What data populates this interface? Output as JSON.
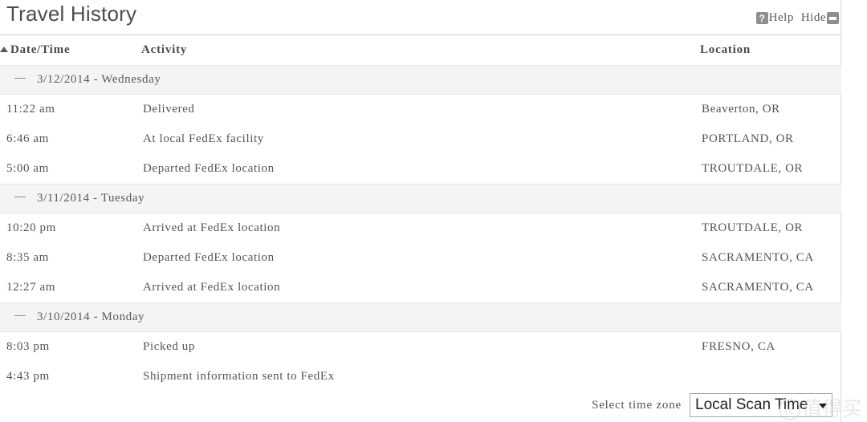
{
  "header": {
    "title": "Travel History",
    "help_label": "Help",
    "help_icon": "question-mark-icon",
    "hide_label": "Hide",
    "hide_icon": "minimize-icon"
  },
  "table": {
    "columns": {
      "datetime": "Date/Time",
      "activity": "Activity",
      "location": "Location"
    },
    "sort": {
      "column": "Date/Time",
      "direction": "ascending",
      "icon": "sort-ascending-triangle-icon"
    },
    "groups": [
      {
        "date": "3/12/2014",
        "separator": "-",
        "weekday": "Wednesday",
        "label": "3/12/2014 - Wednesday",
        "collapse_icon": "collapse-dash-icon",
        "rows": [
          {
            "time": "11:22 am",
            "activity": "Delivered",
            "location": "Beaverton, OR"
          },
          {
            "time": "6:46 am",
            "activity": "At local FedEx facility",
            "location": "PORTLAND, OR"
          },
          {
            "time": "5:00 am",
            "activity": "Departed FedEx location",
            "location": "TROUTDALE, OR"
          }
        ]
      },
      {
        "date": "3/11/2014",
        "separator": "-",
        "weekday": "Tuesday",
        "label": "3/11/2014 - Tuesday",
        "collapse_icon": "collapse-dash-icon",
        "rows": [
          {
            "time": "10:20 pm",
            "activity": "Arrived at FedEx location",
            "location": "TROUTDALE, OR"
          },
          {
            "time": "8:35 am",
            "activity": "Departed FedEx location",
            "location": "SACRAMENTO, CA"
          },
          {
            "time": "12:27 am",
            "activity": "Arrived at FedEx location",
            "location": "SACRAMENTO, CA"
          }
        ]
      },
      {
        "date": "3/10/2014",
        "separator": "-",
        "weekday": "Monday",
        "label": "3/10/2014 - Monday",
        "collapse_icon": "collapse-dash-icon",
        "rows": [
          {
            "time": "8:03 pm",
            "activity": "Picked up",
            "location": "FRESNO, CA"
          },
          {
            "time": "4:43 pm",
            "activity": "Shipment information sent to FedEx",
            "location": ""
          }
        ]
      }
    ]
  },
  "footer": {
    "timezone_label": "Select time zone",
    "timezone_value": "Local Scan Time",
    "timezone_arrow_icon": "chevron-down-icon"
  },
  "watermark": {
    "logo_glyph": "张",
    "text": "值得买"
  },
  "colors": {
    "text": "#545454",
    "title": "#4d4d4d",
    "group_row_bg": "#f4f4f4",
    "border": "#d8d8d8",
    "icon_gray": "#8e8e8e",
    "watermark": "#c9cfc6"
  }
}
